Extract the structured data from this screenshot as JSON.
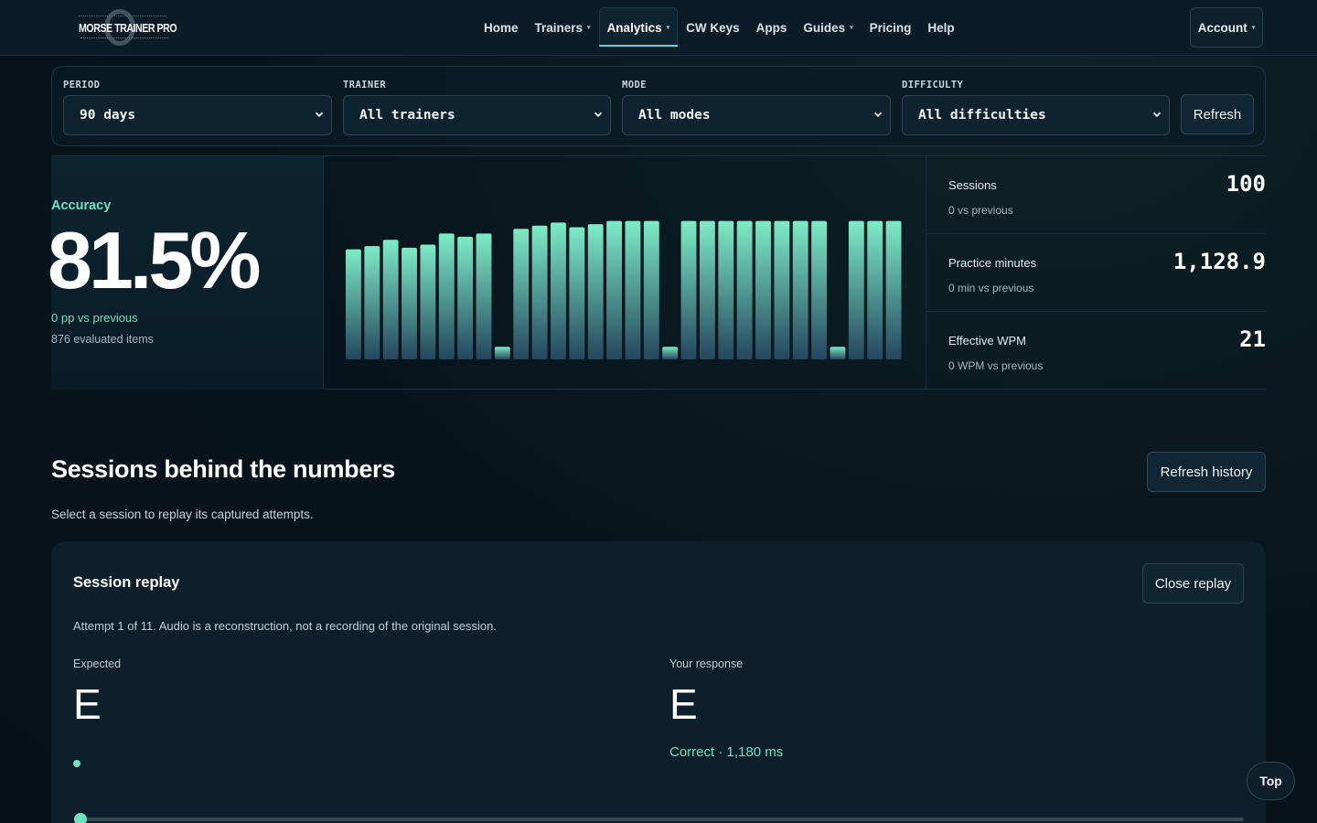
{
  "header": {
    "logo_text": "MORSE TRAINER PRO",
    "nav": [
      {
        "label": "Home",
        "dropdown": false,
        "active": false
      },
      {
        "label": "Trainers",
        "dropdown": true,
        "active": false
      },
      {
        "label": "Analytics",
        "dropdown": true,
        "active": true
      },
      {
        "label": "CW Keys",
        "dropdown": false,
        "active": false
      },
      {
        "label": "Apps",
        "dropdown": false,
        "active": false
      },
      {
        "label": "Guides",
        "dropdown": true,
        "active": false
      },
      {
        "label": "Pricing",
        "dropdown": false,
        "active": false
      },
      {
        "label": "Help",
        "dropdown": false,
        "active": false
      }
    ],
    "account_label": "Account",
    "caret": "▾"
  },
  "filters": {
    "period": {
      "label": "PERIOD",
      "value": "90 days"
    },
    "trainer": {
      "label": "TRAINER",
      "value": "All trainers"
    },
    "mode": {
      "label": "MODE",
      "value": "All modes"
    },
    "difficulty": {
      "label": "DIFFICULTY",
      "value": "All difficulties"
    },
    "refresh_label": "Refresh"
  },
  "accuracy": {
    "label": "Accuracy",
    "value": "81.5%",
    "delta": "0 pp vs previous",
    "items": "876 evaluated items"
  },
  "chart_data": {
    "type": "bar",
    "values": [
      70,
      72,
      76,
      71,
      73,
      80,
      78,
      80,
      8,
      83,
      85,
      87,
      84,
      86,
      88,
      88,
      88,
      8,
      88,
      88,
      88,
      88,
      88,
      88,
      88,
      88,
      8,
      88,
      88,
      88
    ],
    "ylim": [
      0,
      100
    ],
    "colors": {
      "top": "#7eebc6",
      "bottom": "#24465e"
    }
  },
  "kpis": [
    {
      "label": "Sessions",
      "value": "100",
      "delta": "0 vs previous"
    },
    {
      "label": "Practice minutes",
      "value": "1,128.9",
      "delta": "0 min vs previous"
    },
    {
      "label": "Effective WPM",
      "value": "21",
      "delta": "0 WPM vs previous"
    }
  ],
  "sessions": {
    "title": "Sessions behind the numbers",
    "subtitle": "Select a session to replay its captured attempts.",
    "refresh_history_label": "Refresh history"
  },
  "replay": {
    "title": "Session replay",
    "close_label": "Close replay",
    "note": "Attempt 1 of 11. Audio is a reconstruction, not a recording of the original session.",
    "expected_label": "Expected",
    "expected_value": "E",
    "response_label": "Your response",
    "response_value": "E",
    "result": "Correct · 1,180 ms",
    "progress": 0.0
  },
  "top_label": "Top",
  "colors": {
    "accent": "#6fe2c0",
    "nav_active_underline": "#5fd0f0",
    "background": "#08141c"
  }
}
